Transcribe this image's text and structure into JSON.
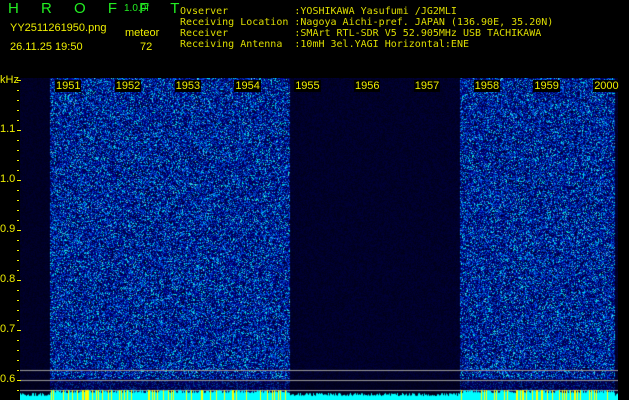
{
  "header": {
    "app_title": "H R O F F T",
    "version": "1.0.0f",
    "filename": "YY2511261950.png",
    "datetime": "26.11.25 19:50",
    "meteor_label": "meteor",
    "meteor_count": "72"
  },
  "info": [
    "Ovserver           :YOSHIKAWA Yasufumi /JG2MLI",
    "Receiving Location :Nagoya Aichi-pref. JAPAN (136.90E, 35.20N)",
    "Receiver           :SMArt RTL-SDR V5 52.905MHz USB TACHIKAWA",
    "Receiving Antenna  :10mH 3el.YAGI Horizontal:ENE"
  ],
  "axis": {
    "y_unit": "kHz",
    "y_labels": [
      "1.1",
      "1.0",
      "0.9",
      "0.8",
      "0.7",
      "0.6"
    ],
    "time_labels": [
      "1951",
      "1952",
      "1953",
      "1954",
      "1955",
      "1956",
      "1957",
      "1958",
      "1959",
      "2000"
    ]
  },
  "colors": {
    "text": "#eeee00",
    "title": "#22ee22",
    "spectrum_floor": "#00ffff",
    "spike": "#ffff00"
  }
}
